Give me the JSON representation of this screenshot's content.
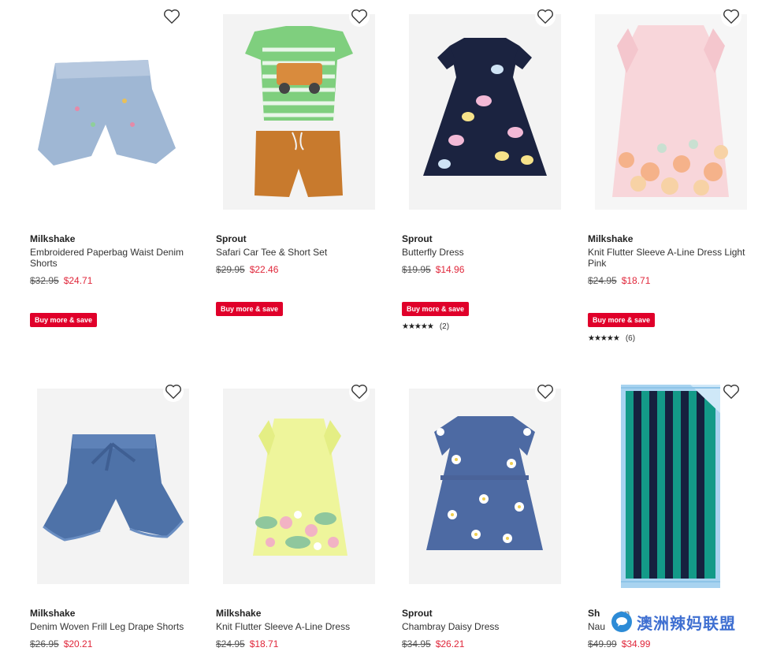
{
  "products": [
    {
      "brand": "Milkshake",
      "name": "Embroidered Paperbag Waist Denim Shorts",
      "was_price": "$32.95",
      "now_price": "$24.71",
      "badge": "Buy more & save",
      "rating_count": ""
    },
    {
      "brand": "Sprout",
      "name": "Safari Car Tee & Short Set",
      "was_price": "$29.95",
      "now_price": "$22.46",
      "badge": "Buy more & save",
      "rating_count": ""
    },
    {
      "brand": "Sprout",
      "name": "Butterfly Dress",
      "was_price": "$19.95",
      "now_price": "$14.96",
      "badge": "Buy more & save",
      "rating_stars": "★★★★★",
      "rating_count": "(2)"
    },
    {
      "brand": "Milkshake",
      "name": "Knit Flutter Sleeve A-Line Dress Light Pink",
      "was_price": "$24.95",
      "now_price": "$18.71",
      "badge": "Buy more & save",
      "rating_stars": "★★★★★",
      "rating_count": "(6)"
    },
    {
      "brand": "Milkshake",
      "name": "Denim Woven Frill Leg Drape Shorts",
      "was_price": "$26.95",
      "now_price": "$20.21"
    },
    {
      "brand": "Milkshake",
      "name": "Knit Flutter Sleeve A-Line Dress",
      "was_price": "$24.95",
      "now_price": "$18.71"
    },
    {
      "brand": "Sprout",
      "name": "Chambray Daisy Dress",
      "was_price": "$34.95",
      "now_price": "$26.21"
    },
    {
      "brand": "Sh",
      "brand_suffix": "an",
      "name": "Nau",
      "was_price": "$49.99",
      "now_price": "$34.99"
    }
  ],
  "watermark": {
    "text": "澳洲辣妈联盟",
    "icon": "chat-bubble-icon"
  },
  "colors": {
    "sale": "#e0263a",
    "badge": "#e0002a"
  }
}
